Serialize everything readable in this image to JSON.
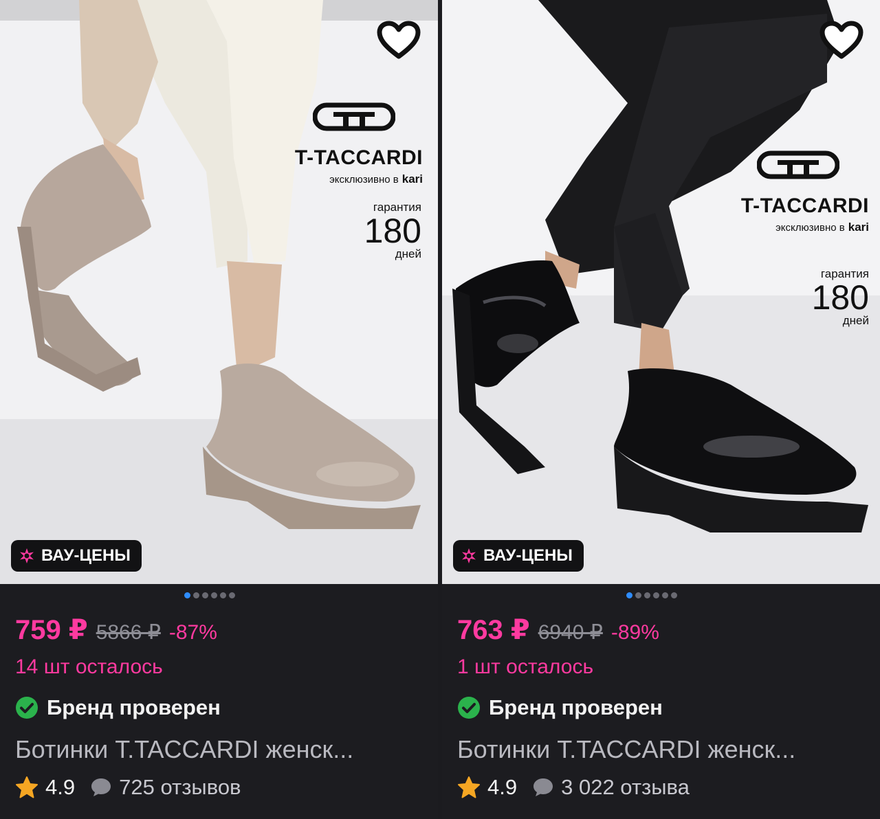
{
  "colors": {
    "accent_pink": "#ff3aa0",
    "verified_green": "#2bb24c",
    "star_yellow": "#f5a623",
    "dot_active": "#2e8cff",
    "card_bg": "#1c1c20"
  },
  "products": [
    {
      "brand_name": "T-TACCARDI",
      "brand_exclusive": "эксклюзивно в",
      "brand_partner": "kari",
      "guarantee_label": "гарантия",
      "guarantee_value": "180",
      "guarantee_unit": "дней",
      "badge": "ВАУ-ЦЕНЫ",
      "price": "759 ₽",
      "old_price": "5866 ₽",
      "discount": "-87%",
      "stock": "14 шт осталось",
      "verified": "Бренд проверен",
      "title": "Ботинки T.TACCARDI женск...",
      "rating": "4.9",
      "reviews": "725 отзывов",
      "image_slides": 6,
      "active_slide": 1,
      "favorite_icon": "heart-outline-icon"
    },
    {
      "brand_name": "T-TACCARDI",
      "brand_exclusive": "эксклюзивно в",
      "brand_partner": "kari",
      "guarantee_label": "гарантия",
      "guarantee_value": "180",
      "guarantee_unit": "дней",
      "badge": "ВАУ-ЦЕНЫ",
      "price": "763 ₽",
      "old_price": "6940 ₽",
      "discount": "-89%",
      "stock": "1 шт осталось",
      "verified": "Бренд проверен",
      "title": "Ботинки T.TACCARDI женск...",
      "rating": "4.9",
      "reviews": "3 022 отзыва",
      "image_slides": 6,
      "active_slide": 1,
      "favorite_icon": "heart-outline-icon"
    }
  ]
}
